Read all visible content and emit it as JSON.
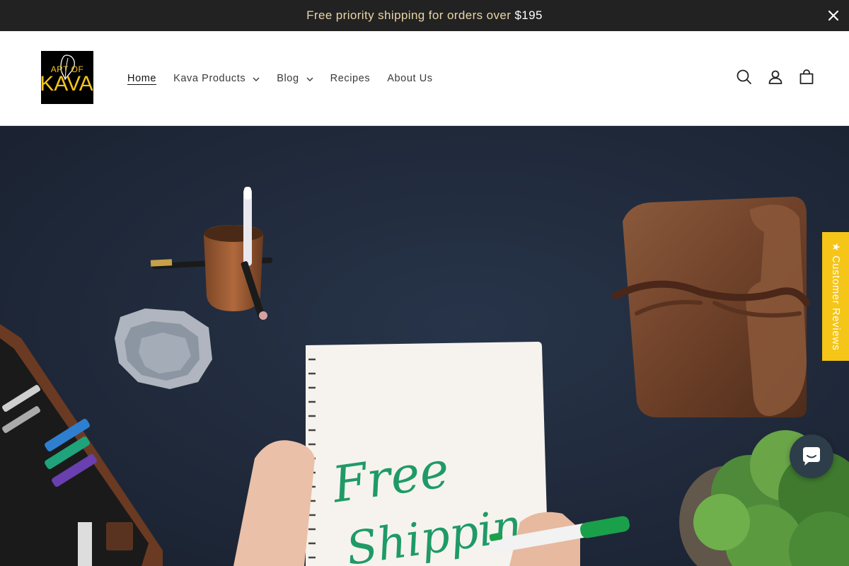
{
  "announcement": {
    "text": "Free priority shipping for orders over ",
    "amount": "$195",
    "close_icon": "close-icon"
  },
  "header": {
    "logo": {
      "line1": "ART OF",
      "line2": "KAVA"
    },
    "nav": [
      {
        "label": "Home",
        "active": true
      },
      {
        "label": "Kava Products",
        "has_dropdown": true
      },
      {
        "label": "Blog",
        "has_dropdown": true
      },
      {
        "label": "Recipes"
      },
      {
        "label": "About Us"
      }
    ],
    "icons": [
      "search-icon",
      "account-icon",
      "cart-icon"
    ]
  },
  "hero": {
    "notebook_text_line1": "Free",
    "notebook_text_line2": "Shipping"
  },
  "reviews_tab": {
    "label": "★ Customer Reviews",
    "color": "#f5c518"
  },
  "chat": {
    "icon": "chat-icon",
    "color": "#2d3d4a"
  },
  "colors": {
    "announcement_bg": "#222222",
    "announcement_text": "#e8d6a8",
    "brand_gold": "#f5c518"
  }
}
